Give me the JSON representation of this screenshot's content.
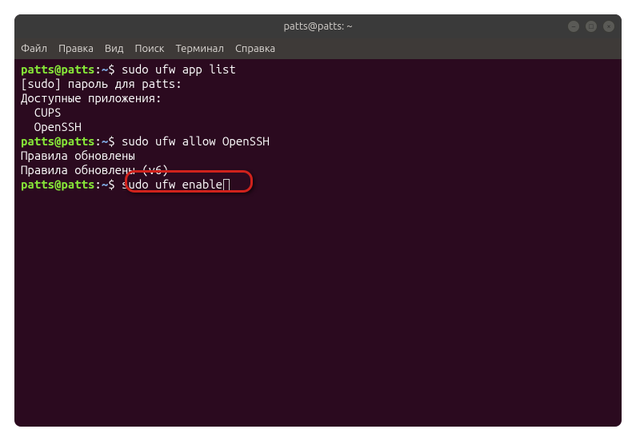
{
  "titlebar": {
    "title": "patts@patts: ~"
  },
  "menubar": {
    "items": [
      "Файл",
      "Правка",
      "Вид",
      "Поиск",
      "Терминал",
      "Справка"
    ]
  },
  "prompt": {
    "userhost": "patts@patts",
    "colon": ":",
    "path": "~",
    "dollar": "$ "
  },
  "lines": {
    "cmd1": "sudo ufw app list",
    "out1": "[sudo] пароль для patts:",
    "out2": "Доступные приложения:",
    "out3": "  CUPS",
    "out4": "  OpenSSH",
    "cmd2": "sudo ufw allow OpenSSH",
    "out5": "Правила обновлены",
    "out6": "Правила обновлены (v6)",
    "cmd3": "sudo ufw enable"
  },
  "window_controls": {
    "minimize": "–",
    "maximize": "□",
    "close": "×"
  }
}
